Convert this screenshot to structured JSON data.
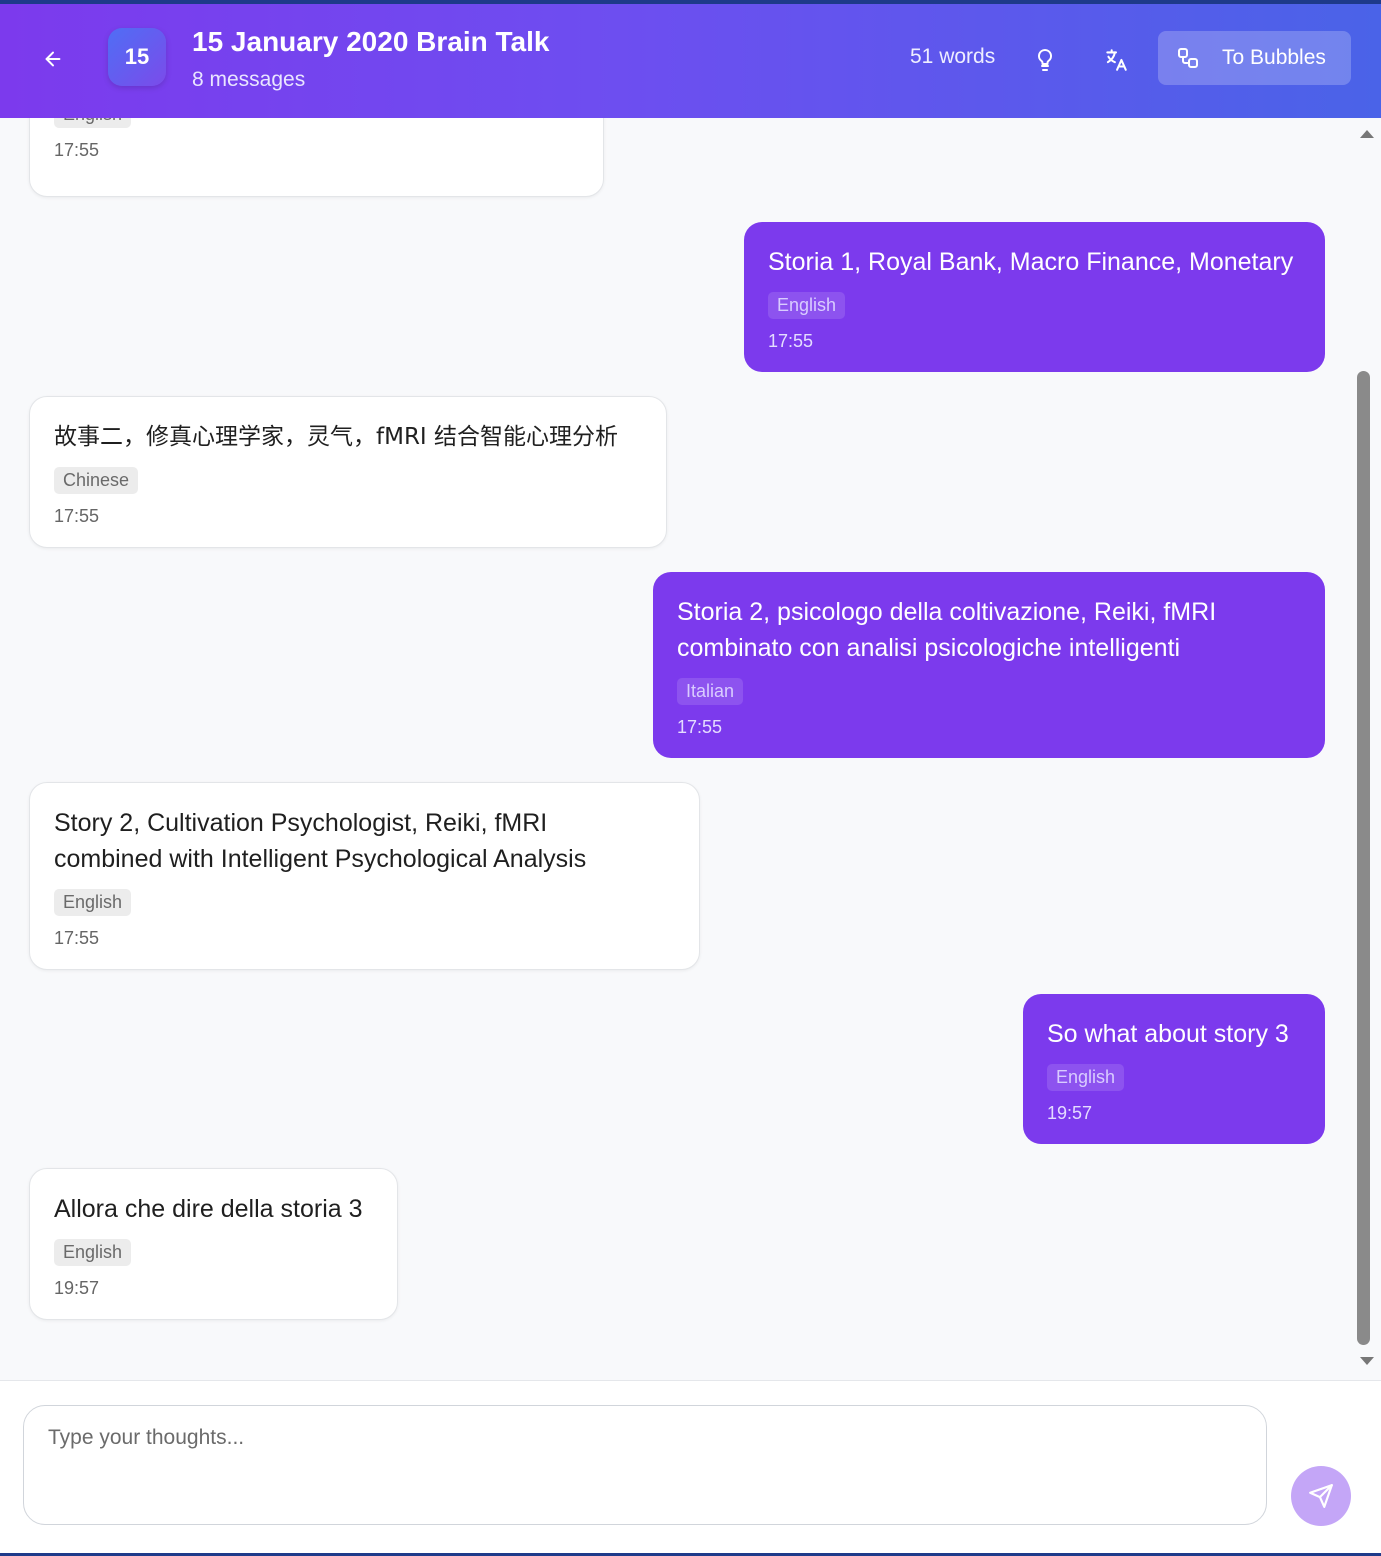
{
  "header": {
    "avatar_text": "15",
    "title": "15 January 2020 Brain Talk",
    "subtitle": "8 messages",
    "word_count": "51 words",
    "to_bubbles_label": "To Bubbles",
    "back_icon": "arrow-left-icon",
    "idea_icon": "lightbulb-icon",
    "translate_icon": "translate-icon",
    "bubbles_icon": "nodes-icon"
  },
  "messages": [
    {
      "side": "received",
      "text": "",
      "lang": "English",
      "time": "17:55"
    },
    {
      "side": "sent",
      "text": "Storia 1, Royal Bank, Macro Finance, Monetary",
      "lang": "English",
      "time": "17:55"
    },
    {
      "side": "received",
      "text": "故事二，修真心理学家，灵气，fMRI 结合智能心理分析",
      "lang": "Chinese",
      "time": "17:55"
    },
    {
      "side": "sent",
      "text": "Storia 2, psicologo della coltivazione, Reiki, fMRI combinato con analisi psicologiche intelligenti",
      "lang": "Italian",
      "time": "17:55"
    },
    {
      "side": "received",
      "text": "Story 2, Cultivation Psychologist, Reiki, fMRI combined with Intelligent Psychological Analysis",
      "lang": "English",
      "time": "17:55"
    },
    {
      "side": "sent",
      "text": "So what about story 3",
      "lang": "English",
      "time": "19:57"
    },
    {
      "side": "received",
      "text": "Allora che dire della storia 3",
      "lang": "English",
      "time": "19:57"
    }
  ],
  "composer": {
    "placeholder": "Type your thoughts...",
    "value": "",
    "send_icon": "send-icon"
  },
  "colors": {
    "header_gradient_start": "#7c3aed",
    "header_gradient_end": "#4a63e8",
    "sent_bubble": "#7c3aed",
    "received_bubble": "#ffffff",
    "send_button": "#c4a6f7"
  }
}
